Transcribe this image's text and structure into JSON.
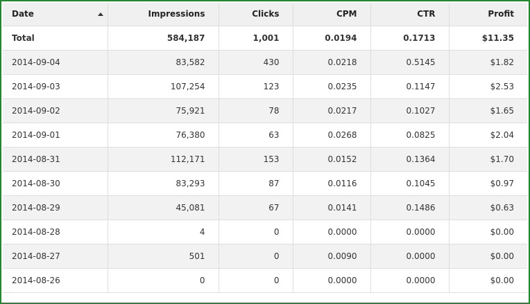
{
  "table": {
    "headers": {
      "date": "Date",
      "impressions": "Impressions",
      "clicks": "Clicks",
      "cpm": "CPM",
      "ctr": "CTR",
      "profit": "Profit"
    },
    "total": {
      "label": "Total",
      "impressions": "584,187",
      "clicks": "1,001",
      "cpm": "0.0194",
      "ctr": "0.1713",
      "profit": "$11.35"
    },
    "rows": [
      {
        "date": "2014-09-04",
        "impressions": "83,582",
        "clicks": "430",
        "cpm": "0.0218",
        "ctr": "0.5145",
        "profit": "$1.82"
      },
      {
        "date": "2014-09-03",
        "impressions": "107,254",
        "clicks": "123",
        "cpm": "0.0235",
        "ctr": "0.1147",
        "profit": "$2.53"
      },
      {
        "date": "2014-09-02",
        "impressions": "75,921",
        "clicks": "78",
        "cpm": "0.0217",
        "ctr": "0.1027",
        "profit": "$1.65"
      },
      {
        "date": "2014-09-01",
        "impressions": "76,380",
        "clicks": "63",
        "cpm": "0.0268",
        "ctr": "0.0825",
        "profit": "$2.04"
      },
      {
        "date": "2014-08-31",
        "impressions": "112,171",
        "clicks": "153",
        "cpm": "0.0152",
        "ctr": "0.1364",
        "profit": "$1.70"
      },
      {
        "date": "2014-08-30",
        "impressions": "83,293",
        "clicks": "87",
        "cpm": "0.0116",
        "ctr": "0.1045",
        "profit": "$0.97"
      },
      {
        "date": "2014-08-29",
        "impressions": "45,081",
        "clicks": "67",
        "cpm": "0.0141",
        "ctr": "0.1486",
        "profit": "$0.63"
      },
      {
        "date": "2014-08-28",
        "impressions": "4",
        "clicks": "0",
        "cpm": "0.0000",
        "ctr": "0.0000",
        "profit": "$0.00"
      },
      {
        "date": "2014-08-27",
        "impressions": "501",
        "clicks": "0",
        "cpm": "0.0090",
        "ctr": "0.0000",
        "profit": "$0.00"
      },
      {
        "date": "2014-08-26",
        "impressions": "0",
        "clicks": "0",
        "cpm": "0.0000",
        "ctr": "0.0000",
        "profit": "$0.00"
      }
    ],
    "sort": {
      "column": "date",
      "direction": "ascending",
      "icon": "sort-up-icon"
    },
    "colors": {
      "frame": "#1e8a2c",
      "header_bg": "#f0f0f0",
      "stripe_bg": "#f2f2f2",
      "grid": "#dedede"
    }
  }
}
